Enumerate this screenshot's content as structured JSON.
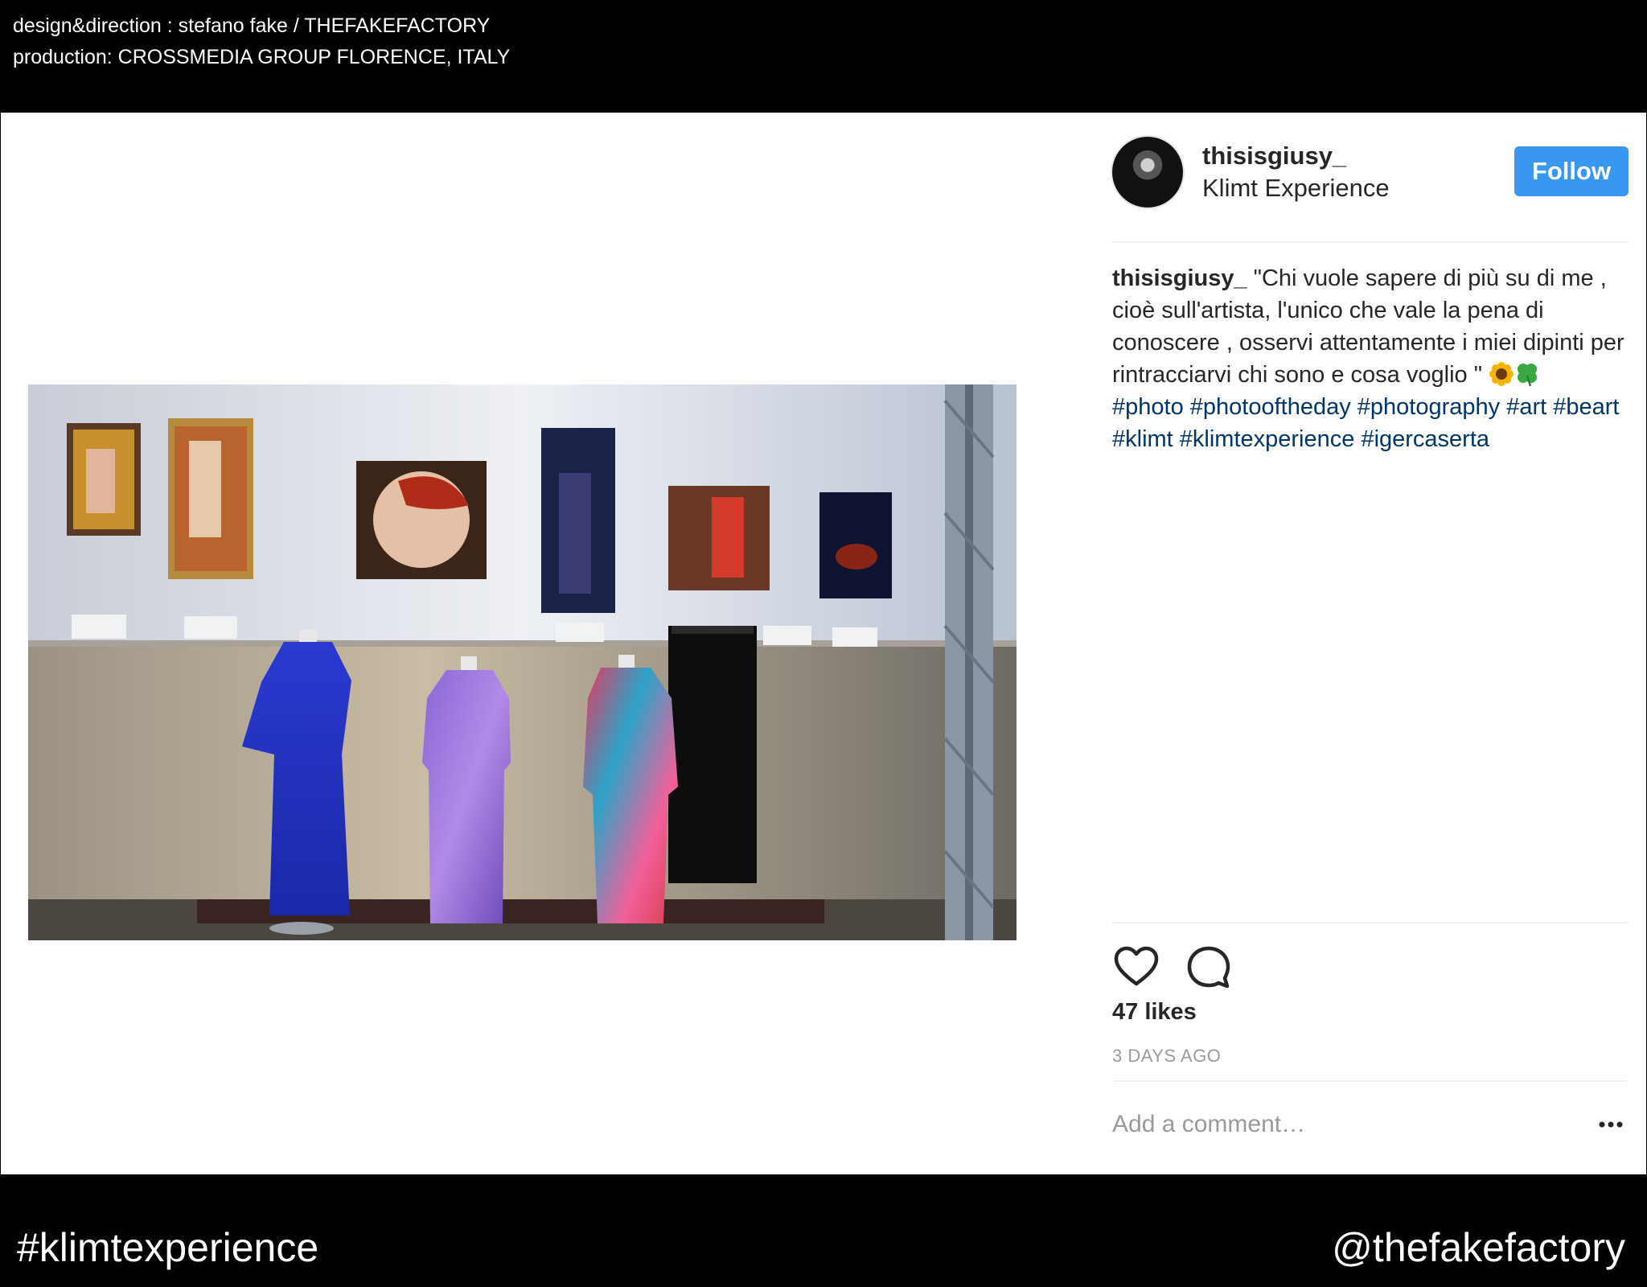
{
  "header": {
    "credit_line_1": "design&direction : stefano fake / THEFAKEFACTORY",
    "credit_line_2": "production: CROSSMEDIA GROUP FLORENCE, ITALY"
  },
  "post": {
    "username": "thisisgiusy_",
    "location": "Klimt Experience",
    "follow_label": "Follow",
    "caption_user": "thisisgiusy_",
    "caption_text": " \"Chi vuole sapere di più su di me , cioè sull'artista, l'unico che vale la pena di conoscere , osservi attentamente i miei dipinti per rintracciarvi chi sono e cosa voglio \" ",
    "emojis": [
      "sunflower-emoji",
      "four-leaf-clover-emoji"
    ],
    "hashtags": "#photo #photooftheday #photography #art #beart #klimt #klimtexperience #igercaserta",
    "likes": "47 likes",
    "time": "3 DAYS AGO",
    "comment_placeholder": "Add a comment…",
    "icons": [
      "heart-icon",
      "comment-icon",
      "more-options-icon"
    ],
    "colors": {
      "follow_button": "#3897f0",
      "hashtag": "#003569",
      "muted": "#999999"
    }
  },
  "footer": {
    "hashtag": "#klimtexperience",
    "handle": "@thefakefactory"
  }
}
